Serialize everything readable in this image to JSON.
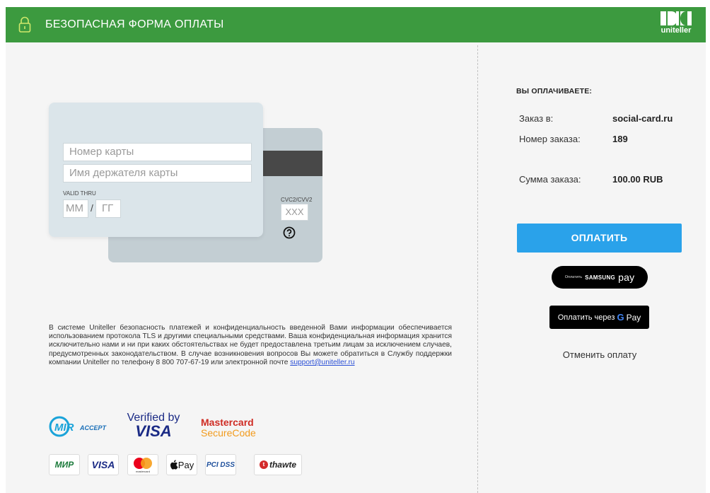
{
  "header": {
    "title": "БЕЗОПАСНАЯ ФОРМА ОПЛАТЫ",
    "logo_text": "uniteller",
    "icon": "lock-icon"
  },
  "card_form": {
    "number_placeholder": "Номер карты",
    "holder_placeholder": "Имя держателя карты",
    "valid_thru_label": "VALID THRU",
    "month_placeholder": "ММ",
    "separator": "/",
    "year_placeholder": "ГГ",
    "cvc_label": "CVC2/CVV2",
    "cvc_placeholder": "XXX",
    "help_icon": "question-circle-icon"
  },
  "disclaimer": {
    "text": "В системе Uniteller безопасность платежей и конфиденциальность введенной Вами информации обеспечивается использованием протокола TLS и другими специальными средствами. Ваша конфиденциальная информация хранится исключительно нами и ни при каких обстоятельствах не будет предоставлена третьим лицам за исключением случаев, предусмотренных законодательством. В случае возникновения вопросов Вы можете обратиться в Службу поддержки компании Uniteller по телефону 8 800 707-67-19 или электронной почте ",
    "email": "support@uniteller.ru"
  },
  "security_logos": {
    "mir_accept_a": "MIR",
    "mir_accept_b": "ACCEPT",
    "verified_line1": "Verified by",
    "verified_line2": "VISA",
    "mastercard_line1": "Mastercard",
    "mastercard_line2": "SecureCode"
  },
  "payment_logos": {
    "mir": "МИР",
    "visa": "VISA",
    "mastercard": "mastercard",
    "apple_pay": "Pay",
    "pci": "PCI DSS",
    "thawte": "thawte",
    "thawte_mark": "t"
  },
  "summary": {
    "heading": "ВЫ ОПЛАЧИВАЕТЕ:",
    "rows": [
      {
        "label": "Заказ в:",
        "value": "social-card.ru"
      },
      {
        "label": "Номер заказа:",
        "value": "189"
      },
      {
        "label": "Сумма заказа:",
        "value": "100.00 RUB"
      }
    ]
  },
  "actions": {
    "pay": "ОПЛАТИТЬ",
    "samsung_small": "Оплатить",
    "samsung_brand": "SAMSUNG",
    "samsung_pay": "pay",
    "gpay_prefix": "Оплатить через",
    "gpay_g": "G",
    "gpay_pay": "Pay",
    "cancel": "Отменить оплату"
  },
  "colors": {
    "header_green": "#3c9a3f",
    "pay_blue": "#2aa2ea",
    "link_blue": "#2a4fd6"
  }
}
